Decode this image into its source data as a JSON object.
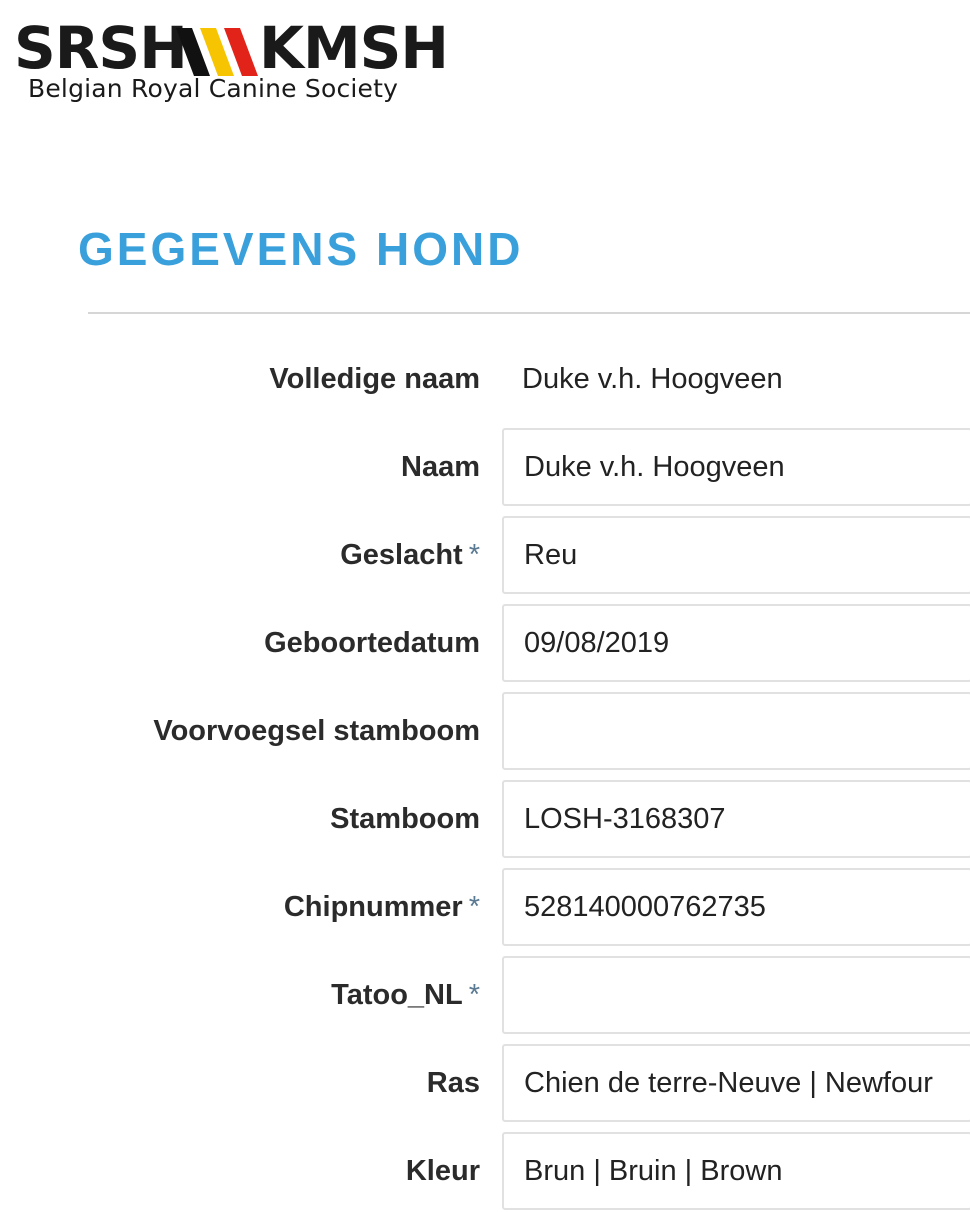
{
  "logo": {
    "left_text": "SRSH",
    "right_text": "KMSH",
    "subtitle": "Belgian Royal Canine Society",
    "stripe_colors": [
      "#111111",
      "#f6c400",
      "#e2231a"
    ]
  },
  "page_title": "GEGEVENS HOND",
  "required_marker": "*",
  "fields": [
    {
      "label": "Volledige naam",
      "value": "Duke v.h. Hoogveen",
      "required": false,
      "plain": true
    },
    {
      "label": "Naam",
      "value": "Duke v.h. Hoogveen",
      "required": false
    },
    {
      "label": "Geslacht",
      "value": "Reu",
      "required": true
    },
    {
      "label": "Geboortedatum",
      "value": "09/08/2019",
      "required": false
    },
    {
      "label": "Voorvoegsel stamboom",
      "value": "",
      "required": false
    },
    {
      "label": "Stamboom",
      "value": "LOSH-3168307",
      "required": false
    },
    {
      "label": "Chipnummer",
      "value": "528140000762735",
      "required": true
    },
    {
      "label": "Tatoo_NL",
      "value": "",
      "required": true
    },
    {
      "label": "Ras",
      "value": "Chien de terre-Neuve | Newfour",
      "required": false
    },
    {
      "label": "Kleur",
      "value": "Brun | Bruin | Brown",
      "required": false
    }
  ]
}
